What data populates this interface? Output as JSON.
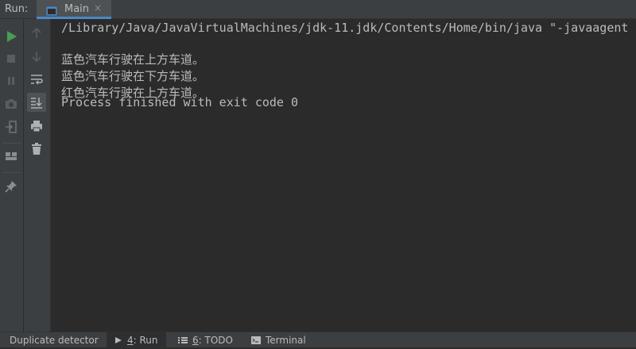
{
  "toolwindow": {
    "title": "Run:"
  },
  "tabs": [
    {
      "label": "Main",
      "close": "×"
    }
  ],
  "console": {
    "lines": [
      "/Library/Java/JavaVirtualMachines/jdk-11.jdk/Contents/Home/bin/java \"-javaagent",
      "蓝色汽车行驶在上方车道。",
      "蓝色汽车行驶在下方车道。",
      "红色汽车行驶在上方车道。",
      "",
      "Process finished with exit code 0"
    ]
  },
  "status": {
    "duplicate": "Duplicate detector",
    "run_num": "4",
    "run_label": ": Run",
    "todo_num": "6",
    "todo_label": ": TODO",
    "terminal": "Terminal"
  },
  "colors": {
    "run_green": "#499c54",
    "tab_accent": "#4a88c7",
    "text": "#bbbbbb"
  },
  "icons": {
    "left_primary": [
      "rerun-icon",
      "stop-icon",
      "pause-icon",
      "camera-icon",
      "login-icon",
      "layout-icon",
      "pin-icon"
    ],
    "left_secondary": [
      "up-icon",
      "down-icon",
      "soft-wrap-icon",
      "scroll-to-end-icon",
      "print-icon",
      "trash-icon"
    ]
  }
}
